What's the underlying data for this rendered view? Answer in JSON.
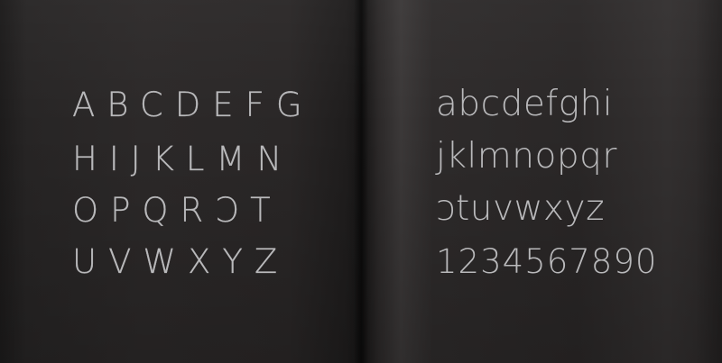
{
  "uppercase_rows": [
    "ABCDEFG",
    "HIJKLMN",
    "OPQRƆT",
    "UVWXYZ"
  ],
  "lowercase_rows": [
    "abcdefghi",
    "jklmnopqr",
    "ɔtuvwxyz"
  ],
  "digits_row": "1234567890",
  "colors": {
    "background": "#2a2727",
    "glyph": "#b9b9bb"
  }
}
